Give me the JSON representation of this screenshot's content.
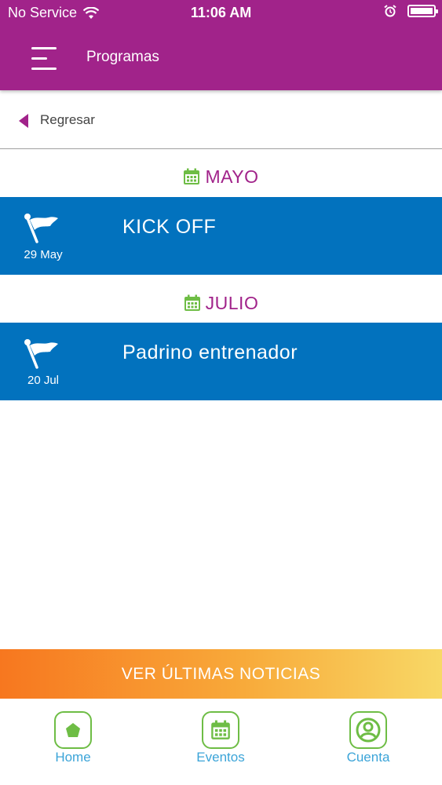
{
  "status": {
    "carrier": "No Service",
    "time": "11:06 AM"
  },
  "header": {
    "title": "Programas"
  },
  "back": {
    "label": "Regresar"
  },
  "months": [
    {
      "label": "MAYO",
      "events": [
        {
          "title": "KICK OFF",
          "date": "29 May",
          "icon": "flag-icon"
        }
      ]
    },
    {
      "label": "JULIO",
      "events": [
        {
          "title": "Padrino entrenador",
          "date": "20 Jul",
          "icon": "flag-icon"
        }
      ]
    }
  ],
  "news": {
    "label": "VER ÚLTIMAS NOTICIAS"
  },
  "tabs": [
    {
      "label": "Home",
      "icon": "home-icon"
    },
    {
      "label": "Eventos",
      "icon": "calendar-icon"
    },
    {
      "label": "Cuenta",
      "icon": "account-icon"
    }
  ],
  "colors": {
    "header": "#a1238a",
    "event_row": "#0272be",
    "month_label": "#a1238a",
    "icon_green": "#6ebd45",
    "tab_label": "#3ba4d8",
    "news_gradient_start": "#f7771f",
    "news_gradient_end": "#f8d866"
  }
}
